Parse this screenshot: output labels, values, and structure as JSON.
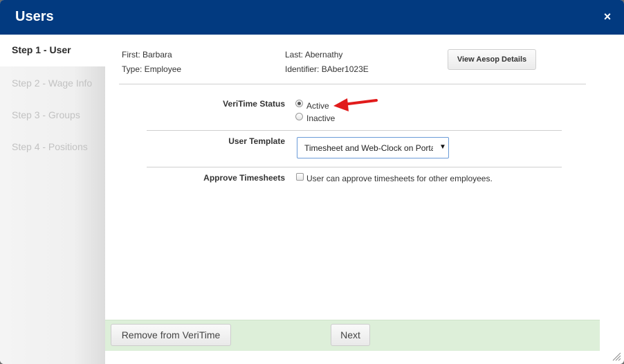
{
  "dialog": {
    "title": "Users",
    "close_glyph": "×"
  },
  "colors": {
    "header": "#023a80",
    "footer": "#ddefd9",
    "arrow": "#e11b1b"
  },
  "steps": [
    {
      "label": "Step 1 - User",
      "active": true
    },
    {
      "label": "Step 2 - Wage Info",
      "active": false
    },
    {
      "label": "Step 3 - Groups",
      "active": false
    },
    {
      "label": "Step 4 - Positions",
      "active": false
    }
  ],
  "user": {
    "first": "First: Barbara",
    "type": "Type: Employee",
    "last": "Last: Abernathy",
    "identifier": "Identifier: BAber1023E"
  },
  "buttons": {
    "view_aesop": "View Aesop Details",
    "remove": "Remove from VeriTime",
    "next": "Next"
  },
  "form": {
    "status_label": "VeriTime Status",
    "status_options": [
      {
        "label": "Active",
        "selected": true
      },
      {
        "label": "Inactive",
        "selected": false
      }
    ],
    "template_label": "User Template",
    "template_value": "Timesheet and Web-Clock on Portal",
    "approve_label": "Approve Timesheets",
    "approve_text": "User can approve timesheets for other employees.",
    "approve_checked": false
  },
  "icons": {
    "close": "close-icon",
    "caret": "caret-down-icon",
    "arrow": "red-arrow-annotation-icon",
    "resize": "resize-grip-icon"
  }
}
